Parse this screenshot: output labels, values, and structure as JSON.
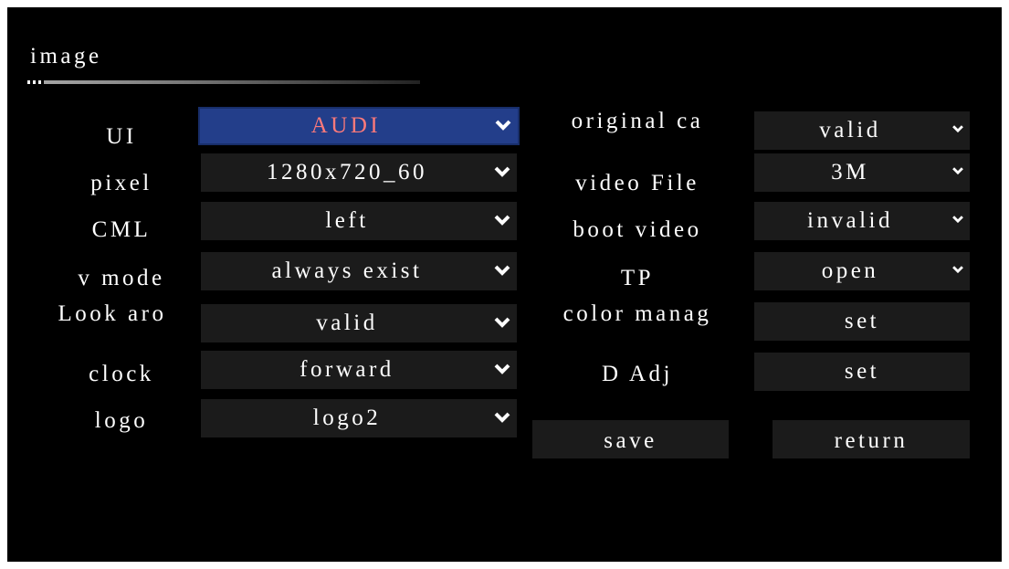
{
  "page": {
    "title": "image"
  },
  "left_rows": [
    {
      "label": "UI",
      "value": "AUDI"
    },
    {
      "label": "pixel",
      "value": "1280x720_60"
    },
    {
      "label": "CML",
      "value": "left"
    },
    {
      "label": "v mode",
      "value": "always exist"
    },
    {
      "label": "Look aro",
      "value": "valid"
    },
    {
      "label": "clock",
      "value": "forward"
    },
    {
      "label": "logo",
      "value": "logo2"
    }
  ],
  "right_rows": [
    {
      "label": "original ca",
      "value": "valid"
    },
    {
      "label": "video File",
      "value": "3M"
    },
    {
      "label": "boot video",
      "value": "invalid"
    },
    {
      "label": "TP",
      "value": "open"
    },
    {
      "label": "color manag",
      "value": "set"
    },
    {
      "label": "D Adj",
      "value": "set"
    }
  ],
  "buttons": {
    "save": "save",
    "return": "return"
  },
  "colors": {
    "background": "#000000",
    "field": "#1b1b1b",
    "selected_field": "#233e8a",
    "selected_text": "#ff7a7a",
    "text": "#ffffff"
  },
  "icons": {
    "dropdown": "chevron-down-icon"
  }
}
